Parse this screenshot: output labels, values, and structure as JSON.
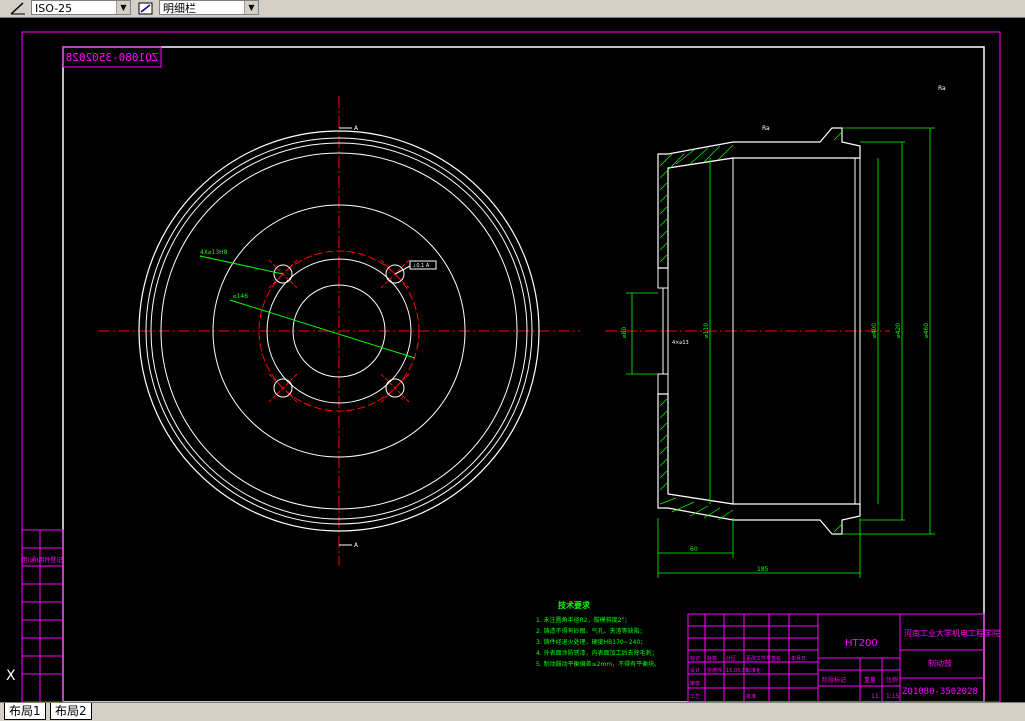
{
  "toolbar": {
    "dimstyle_icon": "dimension-style-icon",
    "dimstyle_value": "ISO-25",
    "textstyle_icon": "text-style-icon",
    "textstyle_value": "明细栏"
  },
  "tabs": [
    {
      "label": "布局1"
    },
    {
      "label": "布局2"
    }
  ],
  "ucs_label": "X",
  "drawing": {
    "mirrored_code": "ZQ1080-3502028",
    "left_view": {
      "hole_label": "4X⌀13H8",
      "pcd_label": "⌀146",
      "section_mark_top": "A",
      "section_mark_bottom": "A",
      "small_tag": "⊥0.1 A"
    },
    "right_view": {
      "dim_bottom_1": "60",
      "dim_bottom_2": "185",
      "dim_left": "⌀80",
      "dim_mid": "⌀110",
      "dim_right_1": "⌀400",
      "dim_right_2": "⌀420",
      "dim_right_3": "⌀460",
      "roughness_top": "Ra",
      "hole_callout": "4×⌀13",
      "corner_mark": "Ra"
    },
    "tech_requirements": {
      "title": "技术要求",
      "items": [
        "1. 未注圆角半径R2，拔模斜度2°；",
        "2. 铸造不得有砂眼、气孔、夹渣等缺陷；",
        "3. 铸件经退火处理，硬度HB170~240；",
        "4. 外表面涂防锈漆，内表面加工后去除毛刺；",
        "5. 制动鼓动平衡偏差≤2mm，不得有平衡块。"
      ]
    },
    "title_block": {
      "material": "HT200",
      "school": "河南工业大学机电工程学院",
      "part_name": "制动鼓",
      "drawing_no": "ZQ1080-3502028",
      "weight": "11",
      "scale": "1:15",
      "heads": [
        "标记",
        "处数",
        "分区",
        "更改文件号",
        "签名",
        "年月日"
      ],
      "row2": [
        "设计",
        "张德伟",
        "15.05.15",
        "标准化"
      ],
      "row3": [
        "审核"
      ],
      "row4": [
        "工艺",
        "批准"
      ],
      "stage_label": "阶段标记",
      "weight_label": "重量",
      "scale_label": "比例"
    },
    "left_strip": [
      "借(通)用件登记",
      "旧底图总号",
      "底图总号",
      "签字",
      "日期"
    ]
  },
  "colors": {
    "sheet_border": "#ff00ff",
    "white_lines": "#ffffff",
    "center_line": "#ff0000",
    "dim_line": "#00ff00",
    "background": "#000000"
  }
}
